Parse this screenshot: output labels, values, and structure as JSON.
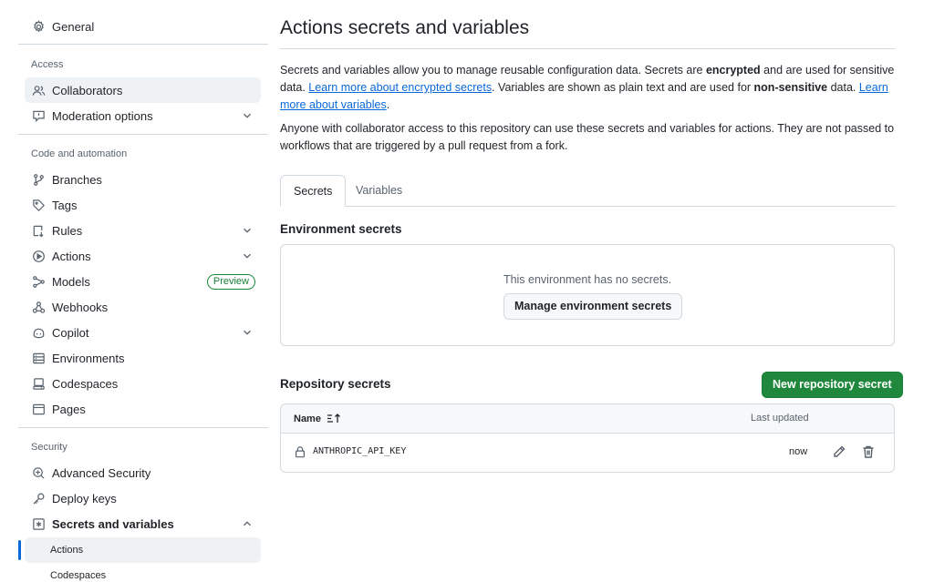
{
  "sidebar": {
    "general": "General",
    "access_heading": "Access",
    "collaborators": "Collaborators",
    "moderation": "Moderation options",
    "code_heading": "Code and automation",
    "branches": "Branches",
    "tags": "Tags",
    "rules": "Rules",
    "actions": "Actions",
    "models": "Models",
    "models_badge": "Preview",
    "webhooks": "Webhooks",
    "copilot": "Copilot",
    "environments": "Environments",
    "codespaces": "Codespaces",
    "pages": "Pages",
    "security_heading": "Security",
    "advanced_security": "Advanced Security",
    "deploy_keys": "Deploy keys",
    "secrets_variables": "Secrets and variables",
    "sub_actions": "Actions",
    "sub_codespaces": "Codespaces"
  },
  "main": {
    "title": "Actions secrets and variables",
    "p1_a": "Secrets and variables allow you to manage reusable configuration data. Secrets are ",
    "p1_b": "encrypted",
    "p1_c": " and are used for sensitive data. ",
    "p1_link1": "Learn more about encrypted secrets",
    "p1_d": ". Variables are shown as plain text and are used for ",
    "p1_e": "non-sensitive",
    "p1_f": " data. ",
    "p1_link2": "Learn more about variables",
    "p1_g": ".",
    "p2": "Anyone with collaborator access to this repository can use these secrets and variables for actions. They are not passed to workflows that are triggered by a pull request from a fork.",
    "tabs": [
      {
        "label": "Secrets"
      },
      {
        "label": "Variables"
      }
    ],
    "env_heading": "Environment secrets",
    "env_empty": "This environment has no secrets.",
    "manage_env_button": "Manage environment secrets",
    "repo_heading": "Repository secrets",
    "new_secret_button": "New repository secret",
    "table": {
      "col_name": "Name",
      "col_updated": "Last updated",
      "rows": [
        {
          "name": "ANTHROPIC_API_KEY",
          "updated": "now"
        }
      ]
    }
  },
  "colors": {
    "accent": "#0969da",
    "primary_button": "#1f883d",
    "border": "#d1d9e0",
    "muted_text": "#59636e"
  },
  "icons": [
    "gear-icon",
    "people-icon",
    "report-icon",
    "branch-icon",
    "tag-icon",
    "rules-icon",
    "play-icon",
    "models-icon",
    "webhook-icon",
    "copilot-icon",
    "server-icon",
    "codespaces-icon",
    "browser-icon",
    "shield-icon",
    "key-icon",
    "asterisk-icon",
    "chevron-down-icon",
    "chevron-up-icon",
    "lock-icon",
    "pencil-icon",
    "trash-icon",
    "sort-icon"
  ]
}
